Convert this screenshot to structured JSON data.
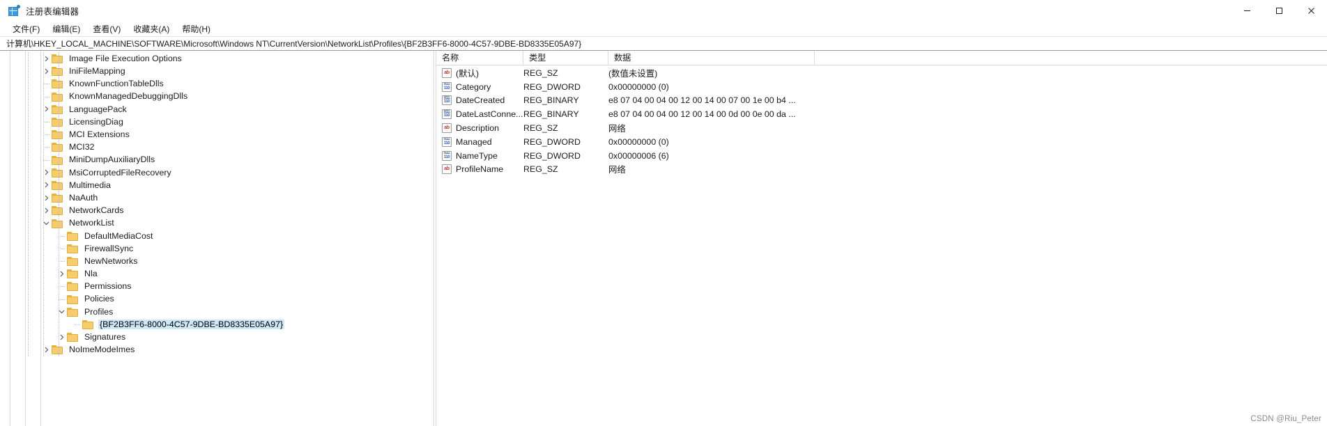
{
  "window": {
    "title": "注册表编辑器",
    "app_icon": "registry-editor-icon",
    "minimize_label": "最小化",
    "maximize_label": "最大化",
    "close_label": "关闭"
  },
  "menubar": {
    "items": [
      {
        "label": "文件(F)",
        "name": "menu-file"
      },
      {
        "label": "编辑(E)",
        "name": "menu-edit"
      },
      {
        "label": "查看(V)",
        "name": "menu-view"
      },
      {
        "label": "收藏夹(A)",
        "name": "menu-favorites"
      },
      {
        "label": "帮助(H)",
        "name": "menu-help"
      }
    ]
  },
  "address": {
    "path": "计算机\\HKEY_LOCAL_MACHINE\\SOFTWARE\\Microsoft\\Windows NT\\CurrentVersion\\NetworkList\\Profiles\\{BF2B3FF6-8000-4C57-9DBE-BD8335E05A97}"
  },
  "tree": {
    "items": [
      {
        "label": "Image File Execution Options",
        "depth": 3,
        "expander": "collapsed",
        "selected": false
      },
      {
        "label": "IniFileMapping",
        "depth": 3,
        "expander": "collapsed",
        "selected": false
      },
      {
        "label": "KnownFunctionTableDlls",
        "depth": 3,
        "expander": "none",
        "selected": false
      },
      {
        "label": "KnownManagedDebuggingDlls",
        "depth": 3,
        "expander": "none",
        "selected": false
      },
      {
        "label": "LanguagePack",
        "depth": 3,
        "expander": "collapsed",
        "selected": false
      },
      {
        "label": "LicensingDiag",
        "depth": 3,
        "expander": "none",
        "selected": false
      },
      {
        "label": "MCI Extensions",
        "depth": 3,
        "expander": "none",
        "selected": false
      },
      {
        "label": "MCI32",
        "depth": 3,
        "expander": "none",
        "selected": false
      },
      {
        "label": "MiniDumpAuxiliaryDlls",
        "depth": 3,
        "expander": "none",
        "selected": false
      },
      {
        "label": "MsiCorruptedFileRecovery",
        "depth": 3,
        "expander": "collapsed",
        "selected": false
      },
      {
        "label": "Multimedia",
        "depth": 3,
        "expander": "collapsed",
        "selected": false
      },
      {
        "label": "NaAuth",
        "depth": 3,
        "expander": "collapsed",
        "selected": false
      },
      {
        "label": "NetworkCards",
        "depth": 3,
        "expander": "collapsed",
        "selected": false
      },
      {
        "label": "NetworkList",
        "depth": 3,
        "expander": "expanded",
        "selected": false
      },
      {
        "label": "DefaultMediaCost",
        "depth": 4,
        "expander": "none",
        "selected": false
      },
      {
        "label": "FirewallSync",
        "depth": 4,
        "expander": "none",
        "selected": false
      },
      {
        "label": "NewNetworks",
        "depth": 4,
        "expander": "none",
        "selected": false
      },
      {
        "label": "Nla",
        "depth": 4,
        "expander": "collapsed",
        "selected": false
      },
      {
        "label": "Permissions",
        "depth": 4,
        "expander": "none",
        "selected": false
      },
      {
        "label": "Policies",
        "depth": 4,
        "expander": "none",
        "selected": false
      },
      {
        "label": "Profiles",
        "depth": 4,
        "expander": "expanded",
        "selected": false
      },
      {
        "label": "{BF2B3FF6-8000-4C57-9DBE-BD8335E05A97}",
        "depth": 5,
        "expander": "none",
        "selected": true
      },
      {
        "label": "Signatures",
        "depth": 4,
        "expander": "collapsed",
        "selected": false
      },
      {
        "label": "NoImeModeImes",
        "depth": 3,
        "expander": "collapsed",
        "selected": false
      }
    ]
  },
  "values": {
    "columns": [
      {
        "label": "名称",
        "name": "column-name"
      },
      {
        "label": "类型",
        "name": "column-type"
      },
      {
        "label": "数据",
        "name": "column-data"
      }
    ],
    "rows": [
      {
        "icon": "string-value-icon",
        "icon_kind": "sz",
        "name": "(默认)",
        "type": "REG_SZ",
        "data": "(数值未设置)"
      },
      {
        "icon": "binary-value-icon",
        "icon_kind": "bin",
        "name": "Category",
        "type": "REG_DWORD",
        "data": "0x00000000 (0)"
      },
      {
        "icon": "binary-value-icon",
        "icon_kind": "bin",
        "name": "DateCreated",
        "type": "REG_BINARY",
        "data": "e8 07 04 00 04 00 12 00 14 00 07 00 1e 00 b4 ..."
      },
      {
        "icon": "binary-value-icon",
        "icon_kind": "bin",
        "name": "DateLastConne...",
        "type": "REG_BINARY",
        "data": "e8 07 04 00 04 00 12 00 14 00 0d 00 0e 00 da ..."
      },
      {
        "icon": "string-value-icon",
        "icon_kind": "sz",
        "name": "Description",
        "type": "REG_SZ",
        "data": "网络"
      },
      {
        "icon": "binary-value-icon",
        "icon_kind": "bin",
        "name": "Managed",
        "type": "REG_DWORD",
        "data": "0x00000000 (0)"
      },
      {
        "icon": "binary-value-icon",
        "icon_kind": "bin",
        "name": "NameType",
        "type": "REG_DWORD",
        "data": "0x00000006 (6)"
      },
      {
        "icon": "string-value-icon",
        "icon_kind": "sz",
        "name": "ProfileName",
        "type": "REG_SZ",
        "data": "网络"
      }
    ]
  },
  "watermark": {
    "text": "CSDN @Riu_Peter"
  },
  "colors": {
    "selection": "#cde8f7",
    "folder": "#f7cd6b",
    "accent": "#3b9ae1"
  }
}
